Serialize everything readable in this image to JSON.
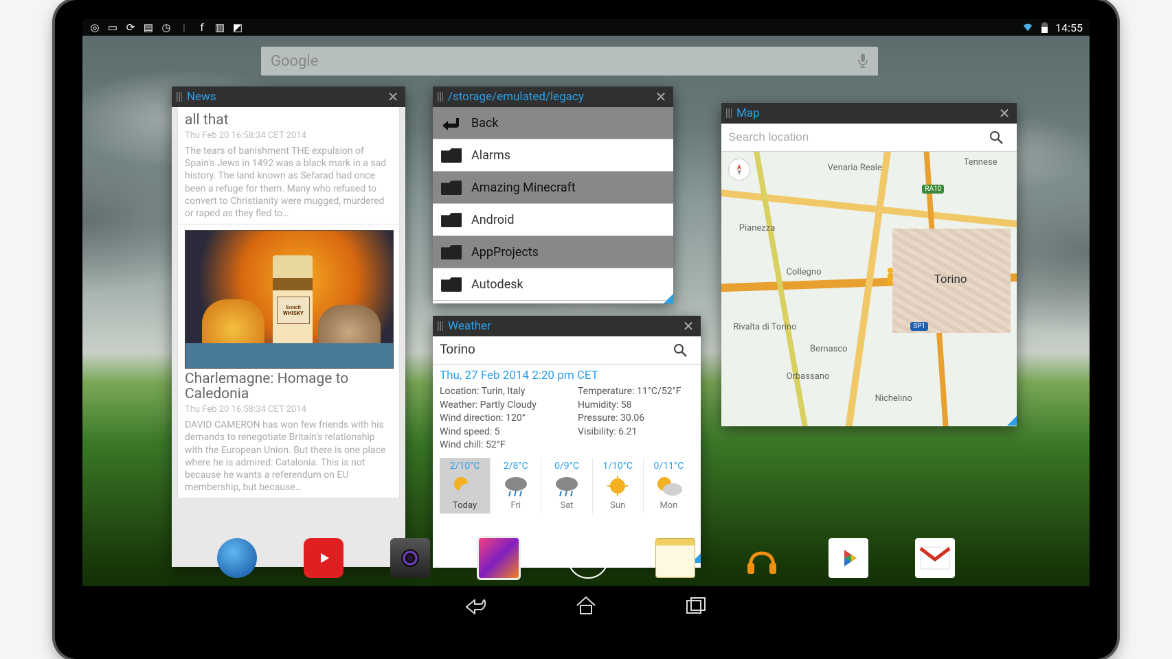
{
  "statusbar": {
    "time": "14:55"
  },
  "search": {
    "brand": "Google"
  },
  "news": {
    "title": "News",
    "items": [
      {
        "headline": "all that",
        "date": "Thu Feb 20 16:58:34 CET 2014",
        "excerpt": "The tears of banishment THE expulsion of Spain's Jews in 1492 was a black mark in a sad history. The land known as Sefarad had once been a refuge for them. Many who refused to convert to Christianity were mugged, murdered or raped as they fled to…"
      },
      {
        "headline": "Charlemagne: Homage to Caledonia",
        "date": "Thu Feb 20 16:58:34 CET 2014",
        "excerpt": "DAVID CAMERON has won few friends with his demands to renegotiate Britain's relationship with the European Union. But there is one place where he is admired: Catalonia. This is not because he wants a referendum on EU membership, but because…",
        "bottle_label_top": "Scotch",
        "bottle_label_bottom": "WHISKY"
      }
    ]
  },
  "filebrowser": {
    "title": "/storage/emulated/legacy",
    "items": [
      {
        "type": "back",
        "label": "Back"
      },
      {
        "type": "folder",
        "label": "Alarms"
      },
      {
        "type": "folder",
        "label": "Amazing Minecraft"
      },
      {
        "type": "folder",
        "label": "Android"
      },
      {
        "type": "folder",
        "label": "AppProjects"
      },
      {
        "type": "folder",
        "label": "Autodesk"
      }
    ]
  },
  "weather": {
    "title": "Weather",
    "query": "Torino",
    "timestamp": "Thu, 27 Feb 2014 2:20 pm CET",
    "left": {
      "location_lbl": "Location:",
      "location": "Turin, Italy",
      "weather_lbl": "Weather:",
      "weather": "Partly Cloudy",
      "winddir_lbl": "Wind direction:",
      "winddir": "120°",
      "windspd_lbl": "Wind speed:",
      "windspd": "5",
      "windchill_lbl": "Wind chill:",
      "windchill": "52°F"
    },
    "right": {
      "temp_lbl": "Temperature:",
      "temp": "11°C/52°F",
      "humidity_lbl": "Humidity:",
      "humidity": "58",
      "pressure_lbl": "Pressure:",
      "pressure": "30.06",
      "visibility_lbl": "Visibility:",
      "visibility": "6.21"
    },
    "forecast": [
      {
        "temp": "2/10°C",
        "icon": "sun-cloud",
        "day": "Today"
      },
      {
        "temp": "2/8°C",
        "icon": "rain",
        "day": "Fri"
      },
      {
        "temp": "0/9°C",
        "icon": "rain",
        "day": "Sat"
      },
      {
        "temp": "1/10°C",
        "icon": "sun",
        "day": "Sun"
      },
      {
        "temp": "0/11°C",
        "icon": "sun-cloud",
        "day": "Mon"
      }
    ]
  },
  "map": {
    "title": "Map",
    "placeholder": "Search location",
    "labels": [
      "Venaria Reale",
      "Torino",
      "Pianezza",
      "Collegno",
      "Nichelino",
      "Orbassano",
      "Bernasco",
      "Rivalta di Torino",
      "Tennese"
    ],
    "road_badges": [
      "RA10",
      "SP1"
    ]
  },
  "dock": {
    "apps": [
      "browser",
      "youtube",
      "camera",
      "gallery",
      "app-drawer",
      "notes",
      "play-music",
      "play-store",
      "gmail"
    ]
  }
}
